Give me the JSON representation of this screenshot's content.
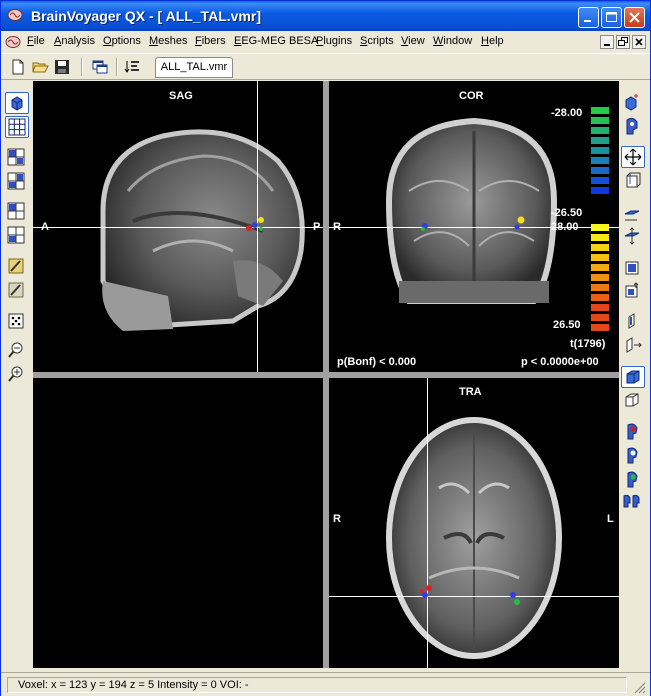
{
  "window": {
    "title": "BrainVoyager QX - [ ALL_TAL.vmr]"
  },
  "menubar": {
    "items": [
      {
        "label": "File",
        "u": "F",
        "rest": "ile"
      },
      {
        "label": "Analysis",
        "u": "A",
        "rest": "nalysis"
      },
      {
        "label": "Options",
        "u": "O",
        "rest": "ptions"
      },
      {
        "label": "Meshes",
        "u": "M",
        "rest": "eshes"
      },
      {
        "label": "Fibers",
        "u": "F",
        "rest": "ibers"
      },
      {
        "label": "EEG-MEG BESA",
        "u": "E",
        "rest": "EG-MEG BESA"
      },
      {
        "label": "Plugins",
        "u": "P",
        "rest": "lugins"
      },
      {
        "label": "Scripts",
        "u": "S",
        "rest": "cripts"
      },
      {
        "label": "View",
        "u": "V",
        "rest": "iew"
      },
      {
        "label": "Window",
        "u": "W",
        "rest": "indow"
      },
      {
        "label": "Help",
        "u": "H",
        "rest": "elp"
      }
    ]
  },
  "toolbar": {
    "doc_tab": "ALL_TAL.vmr"
  },
  "viewer": {
    "sag_label": "SAG",
    "cor_label": "COR",
    "tra_label": "TRA",
    "sag_left": "A",
    "sag_right": "P",
    "cor_left": "R",
    "tra_left": "R",
    "tra_right": "L",
    "pbonf": "p(Bonf) < 0.000",
    "pvalue": "p < 0.0000e+00",
    "tlabel": "t(1796)",
    "colorbar": {
      "neg_top": "-28.00",
      "neg_bottom": "-26.50",
      "pos_top": "28.00",
      "pos_bottom": "26.50",
      "neg_colors": [
        "#22CC44",
        "#22C055",
        "#20B070",
        "#1FA088",
        "#1C90A0",
        "#1A7EB8",
        "#1868C8",
        "#1550D8",
        "#1238E0"
      ],
      "pos_colors": [
        "#F8F820",
        "#F8E818",
        "#F8D410",
        "#F8C010",
        "#F5A810",
        "#F29010",
        "#EE7810",
        "#EA6010",
        "#E54818"
      ]
    }
  },
  "status": {
    "text": "Voxel:  x = 123 y = 194 z = 5  Intensity = 0  VOI: -"
  }
}
